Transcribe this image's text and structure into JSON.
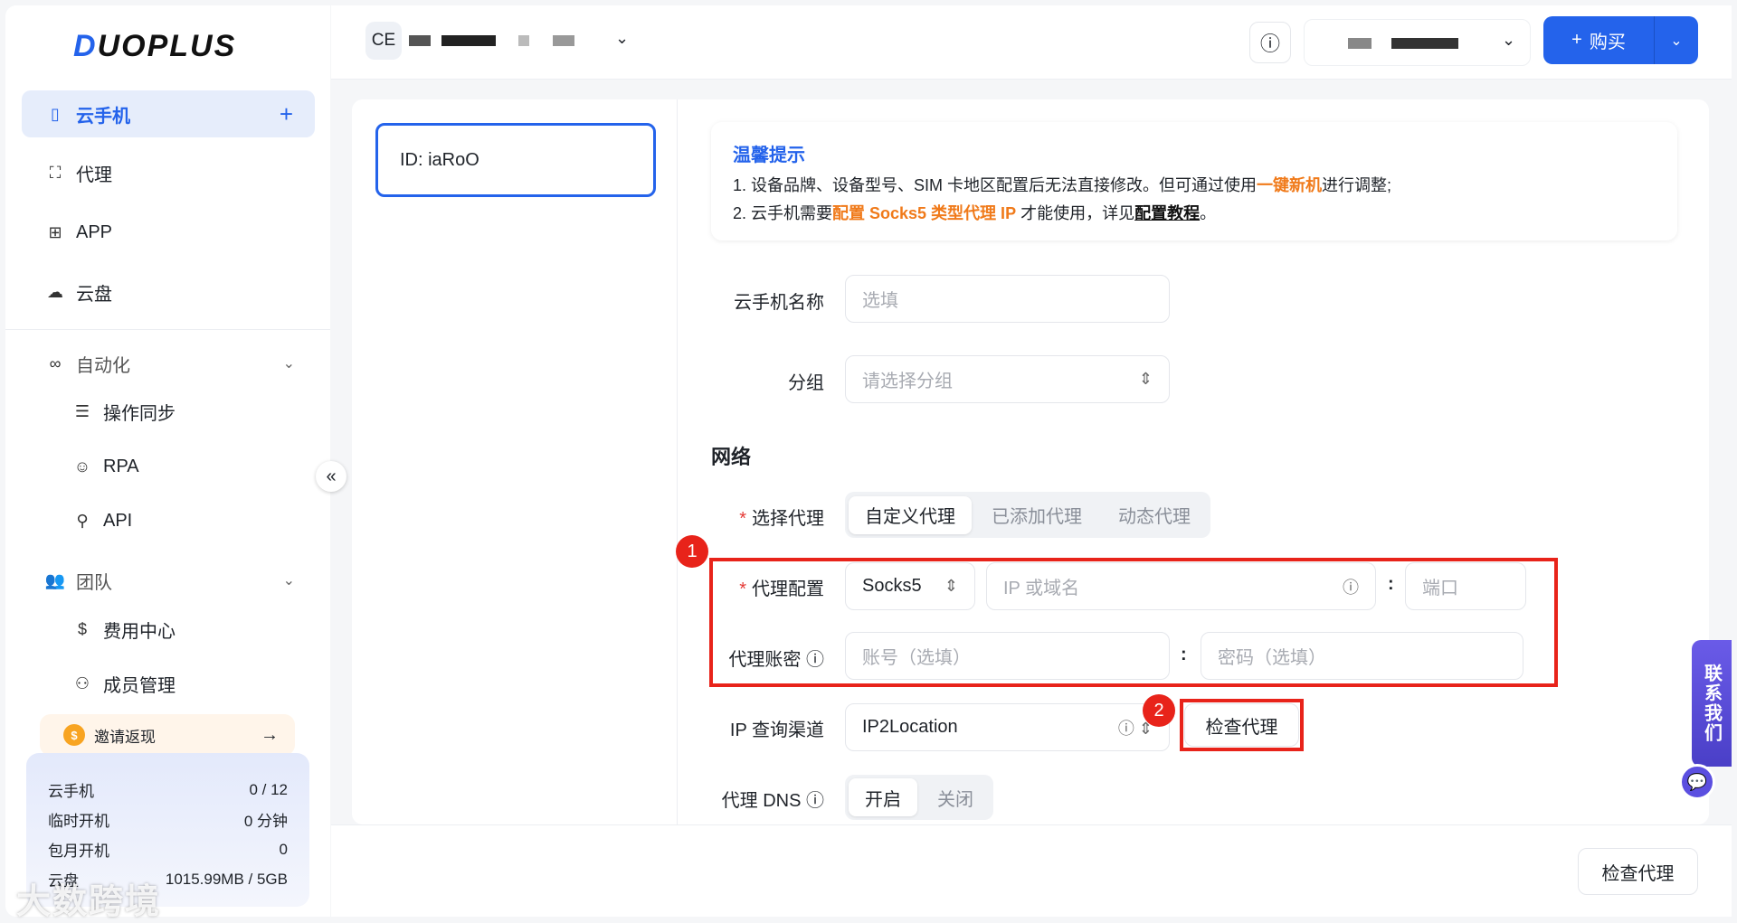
{
  "brand": {
    "logo_first": "D",
    "logo_rest": "UOPLUS",
    "accent": "#2463eb"
  },
  "sidebar": {
    "items": [
      {
        "label": "云手机",
        "icon": "phone-icon"
      },
      {
        "label": "代理",
        "icon": "network-icon"
      },
      {
        "label": "APP",
        "icon": "apps-grid-icon"
      },
      {
        "label": "云盘",
        "icon": "cloud-icon"
      }
    ],
    "automation": {
      "label": "自动化",
      "items": [
        "操作同步",
        "RPA",
        "API"
      ]
    },
    "team": {
      "label": "团队",
      "items": [
        "费用中心",
        "成员管理"
      ]
    },
    "invite": {
      "label": "邀请返现"
    },
    "stats": [
      {
        "label": "云手机",
        "value": "0 / 12"
      },
      {
        "label": "临时开机",
        "value": "0 分钟"
      },
      {
        "label": "包月开机",
        "value": "0"
      },
      {
        "label": "云盘",
        "value": "1015.99MB / 5GB"
      }
    ],
    "watermark": "大数跨境"
  },
  "header": {
    "workspace_badge": "CE",
    "buy_label": "购买"
  },
  "device": {
    "id_label": "ID: iaRoO"
  },
  "notice": {
    "title": "温馨提示",
    "line1_a": "1. 设备品牌、设备型号、SIM 卡地区配置后无法直接修改。但可通过使用",
    "line1_hl": "一键新机",
    "line1_b": "进行调整;",
    "line2_a": "2. 云手机需要",
    "line2_hl": "配置 Socks5 类型代理 IP",
    "line2_b": " 才能使用，详见",
    "line2_link": "配置教程",
    "line2_end": "。"
  },
  "form": {
    "name": {
      "label": "云手机名称",
      "placeholder": "选填"
    },
    "group": {
      "label": "分组",
      "placeholder": "请选择分组"
    },
    "network_title": "网络",
    "proxy_select": {
      "label": "选择代理",
      "options": [
        "自定义代理",
        "已添加代理",
        "动态代理"
      ],
      "selected": "自定义代理"
    },
    "proxy_config": {
      "label": "代理配置",
      "type": "Socks5",
      "host_placeholder": "IP 或域名",
      "port_placeholder": "端口"
    },
    "proxy_auth": {
      "label": "代理账密",
      "user_placeholder": "账号（选填）",
      "pass_placeholder": "密码（选填）"
    },
    "ip_channel": {
      "label": "IP 查询渠道",
      "value": "IP2Location",
      "check_button": "检查代理"
    },
    "dns": {
      "label": "代理 DNS",
      "options": [
        "开启",
        "关闭"
      ],
      "selected": "开启"
    }
  },
  "annotations": {
    "badge1": "1",
    "badge2": "2",
    "color": "#e8231a"
  },
  "footer": {
    "check_button": "检查代理"
  },
  "contact": {
    "label": "联系我们"
  }
}
